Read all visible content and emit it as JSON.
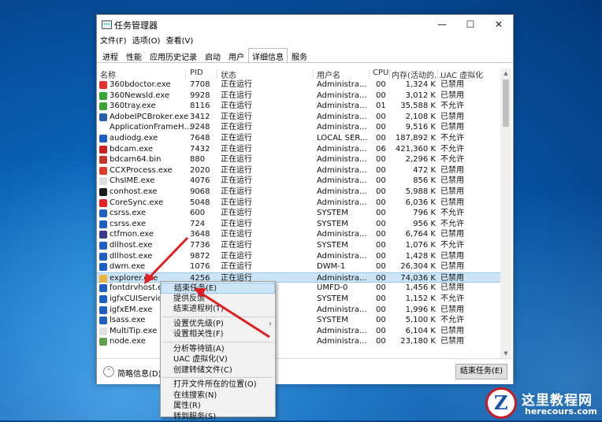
{
  "window": {
    "title": "任务管理器",
    "controls": {
      "minimize": "—",
      "maximize": "☐",
      "close": "✕"
    }
  },
  "menu": [
    "文件(F)",
    "选项(O)",
    "查看(V)"
  ],
  "tabs": [
    "进程",
    "性能",
    "应用历史记录",
    "启动",
    "用户",
    "详细信息",
    "服务"
  ],
  "active_tab": "详细信息",
  "columns": [
    "名称",
    "PID",
    "状态",
    "用户名",
    "CPU",
    "内存(活动的...",
    "UAC 虚拟化"
  ],
  "rows": [
    {
      "name": "360bdoctor.exe",
      "pid": "7708",
      "status": "正在运行",
      "user": "Administra...",
      "cpu": "00",
      "mem": "1,324 K",
      "uac": "已禁用",
      "icon": "#e03030"
    },
    {
      "name": "360Newsld.exe",
      "pid": "9928",
      "status": "正在运行",
      "user": "Administra...",
      "cpu": "00",
      "mem": "3,012 K",
      "uac": "已禁用",
      "icon": "#3aa534"
    },
    {
      "name": "360tray.exe",
      "pid": "8116",
      "status": "正在运行",
      "user": "Administra...",
      "cpu": "01",
      "mem": "35,588 K",
      "uac": "不允许",
      "icon": "#3aa534"
    },
    {
      "name": "AdobeIPCBroker.exe",
      "pid": "3412",
      "status": "正在运行",
      "user": "Administra...",
      "cpu": "00",
      "mem": "2,108 K",
      "uac": "已禁用",
      "icon": "#2b5ea8"
    },
    {
      "name": "ApplicationFrameH...",
      "pid": "9248",
      "status": "正在运行",
      "user": "Administra...",
      "cpu": "00",
      "mem": "9,516 K",
      "uac": "已禁用",
      "icon": "#ffffff"
    },
    {
      "name": "audiodg.exe",
      "pid": "7648",
      "status": "正在运行",
      "user": "LOCAL SER...",
      "cpu": "00",
      "mem": "187,892 K",
      "uac": "不允许",
      "icon": "#1f5fbf"
    },
    {
      "name": "bdcam.exe",
      "pid": "7432",
      "status": "正在运行",
      "user": "Administra...",
      "cpu": "06",
      "mem": "421,360 K",
      "uac": "不允许",
      "icon": "#d01e1e"
    },
    {
      "name": "bdcam64.bin",
      "pid": "880",
      "status": "正在运行",
      "user": "Administra...",
      "cpu": "00",
      "mem": "2,296 K",
      "uac": "不允许",
      "icon": "#c0392b"
    },
    {
      "name": "CCXProcess.exe",
      "pid": "2020",
      "status": "正在运行",
      "user": "Administra...",
      "cpu": "00",
      "mem": "472 K",
      "uac": "已禁用",
      "icon": "#e03a2b"
    },
    {
      "name": "ChsIME.exe",
      "pid": "4076",
      "status": "正在运行",
      "user": "Administra...",
      "cpu": "00",
      "mem": "856 K",
      "uac": "已禁用",
      "icon": "#dddddd"
    },
    {
      "name": "conhost.exe",
      "pid": "9068",
      "status": "正在运行",
      "user": "Administra...",
      "cpu": "00",
      "mem": "5,988 K",
      "uac": "已禁用",
      "icon": "#1b1b1b"
    },
    {
      "name": "CoreSync.exe",
      "pid": "5048",
      "status": "正在运行",
      "user": "Administra...",
      "cpu": "00",
      "mem": "6,036 K",
      "uac": "已禁用",
      "icon": "#e02424"
    },
    {
      "name": "csrss.exe",
      "pid": "600",
      "status": "正在运行",
      "user": "SYSTEM",
      "cpu": "00",
      "mem": "796 K",
      "uac": "不允许",
      "icon": "#1f5fbf"
    },
    {
      "name": "csrss.exe",
      "pid": "724",
      "status": "正在运行",
      "user": "SYSTEM",
      "cpu": "00",
      "mem": "956 K",
      "uac": "不允许",
      "icon": "#1f5fbf"
    },
    {
      "name": "ctfmon.exe",
      "pid": "3648",
      "status": "正在运行",
      "user": "Administra...",
      "cpu": "00",
      "mem": "6,764 K",
      "uac": "已禁用",
      "icon": "#3a3a8a"
    },
    {
      "name": "dllhost.exe",
      "pid": "7736",
      "status": "正在运行",
      "user": "SYSTEM",
      "cpu": "00",
      "mem": "1,076 K",
      "uac": "不允许",
      "icon": "#1f5fbf"
    },
    {
      "name": "dllhost.exe",
      "pid": "9872",
      "status": "正在运行",
      "user": "Administra...",
      "cpu": "00",
      "mem": "1,428 K",
      "uac": "已禁用",
      "icon": "#1f5fbf"
    },
    {
      "name": "dwm.exe",
      "pid": "1076",
      "status": "正在运行",
      "user": "DWM-1",
      "cpu": "00",
      "mem": "26,304 K",
      "uac": "已禁用",
      "icon": "#1f5fbf"
    },
    {
      "name": "explorer.exe",
      "pid": "4256",
      "status": "正在运行",
      "user": "Administra...",
      "cpu": "00",
      "mem": "74,036 K",
      "uac": "已禁用",
      "icon": "#e8b33a"
    },
    {
      "name": "fontdrvhost.exe",
      "pid": "",
      "status": "",
      "user": "UMFD-0",
      "cpu": "00",
      "mem": "1,456 K",
      "uac": "已禁用",
      "icon": "#1f5fbf"
    },
    {
      "name": "igfxCUIService",
      "pid": "",
      "status": "",
      "user": "SYSTEM",
      "cpu": "00",
      "mem": "1,152 K",
      "uac": "不允许",
      "icon": "#1f5fbf"
    },
    {
      "name": "igfxEM.exe",
      "pid": "",
      "status": "",
      "user": "Administra...",
      "cpu": "00",
      "mem": "1,996 K",
      "uac": "已禁用",
      "icon": "#1f5fbf"
    },
    {
      "name": "lsass.exe",
      "pid": "",
      "status": "",
      "user": "SYSTEM",
      "cpu": "00",
      "mem": "5,100 K",
      "uac": "不允许",
      "icon": "#1f5fbf"
    },
    {
      "name": "MultiTip.exe",
      "pid": "",
      "status": "",
      "user": "Administra...",
      "cpu": "00",
      "mem": "6,104 K",
      "uac": "已禁用",
      "icon": "#e0e0e0"
    },
    {
      "name": "node.exe",
      "pid": "",
      "status": "",
      "user": "Administra...",
      "cpu": "00",
      "mem": "23,180 K",
      "uac": "已禁用",
      "icon": "#5fa04e"
    }
  ],
  "selected_row": 18,
  "footer": {
    "fewer_details": "简略信息(D)",
    "end_task": "结束任务(E)"
  },
  "context_menu": [
    {
      "label": "结束任务(E)"
    },
    {
      "label": "提供反馈"
    },
    {
      "label": "结束进程树(T)"
    },
    {
      "sep": true
    },
    {
      "label": "设置优先级(P)",
      "submenu": true
    },
    {
      "label": "设置相关性(F)"
    },
    {
      "sep": true
    },
    {
      "label": "分析等待链(A)"
    },
    {
      "label": "UAC 虚拟化(V)"
    },
    {
      "label": "创建转储文件(C)"
    },
    {
      "sep": true
    },
    {
      "label": "打开文件所在的位置(O)"
    },
    {
      "label": "在线搜索(N)"
    },
    {
      "label": "属性(R)"
    },
    {
      "label": "转到服务(S)"
    }
  ],
  "context_highlight": 0,
  "watermark": {
    "cn": "这里教程网",
    "en": "herecours.com",
    "logo_letter": "Z"
  },
  "colors": {
    "accent": "#cce4f7",
    "annotation_arrow": "#e02020",
    "watermark_red": "#c51d23"
  }
}
